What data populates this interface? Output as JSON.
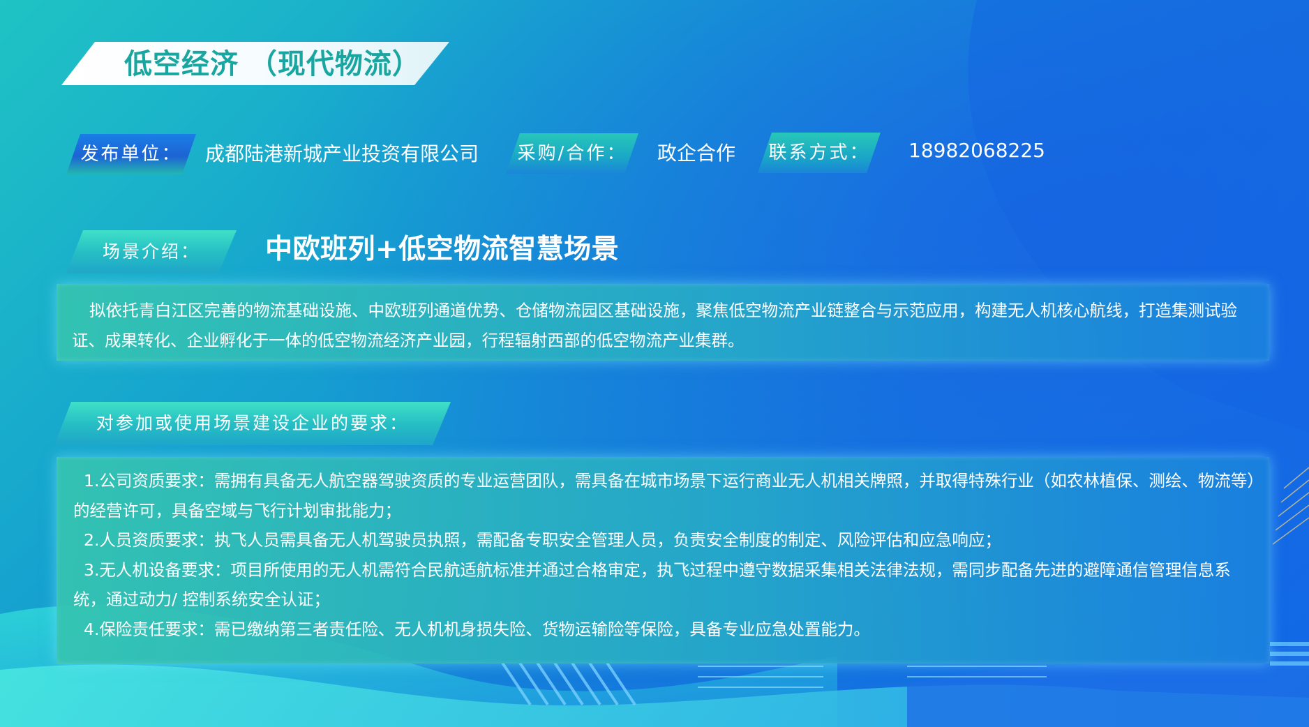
{
  "title": "低空经济 （现代物流）",
  "info": {
    "publisher_label": "发布单位：",
    "publisher_value": "成都陆港新城产业投资有限公司",
    "cooperation_label": "采购/合作：",
    "cooperation_value": "政企合作",
    "contact_label": "联系方式：",
    "contact_value": "18982068225"
  },
  "scene": {
    "label": "场景介绍：",
    "heading": "中欧班列+低空物流智慧场景",
    "description": "拟依托青白江区完善的物流基础设施、中欧班列通道优势、仓储物流园区基础设施，聚焦低空物流产业链整合与示范应用，构建无人机核心航线，打造集测试验证、成果转化、企业孵化于一体的低空物流经济产业园，行程辐射西部的低空物流产业集群。"
  },
  "requirements": {
    "label": "对参加或使用场景建设企业的要求：",
    "items": [
      "1.公司资质要求：需拥有具备无人航空器驾驶资质的专业运营团队，需具备在城市场景下运行商业无人机相关牌照，并取得特殊行业（如农林植保、测绘、物流等）的经营许可，具备空域与飞行计划审批能力；",
      "2.人员资质要求：执飞人员需具备无人机驾驶员执照，需配备专职安全管理人员，负责安全制度的制定、风险评估和应急响应；",
      "3.无人机设备要求：项目所使用的无人机需符合民航适航标准并通过合格审定，执飞过程中遵守数据采集相关法律法规，需同步配备先进的避障通信管理信息系统，通过动力/ 控制系统安全认证；",
      "4.保险责任要求：需已缴纳第三者责任险、无人机机身损失险、货物运输险等保险，具备专业应急处置能力。"
    ]
  },
  "colors": {
    "title_text": "#1aa6a0",
    "panel_start": "#35c4b0",
    "panel_end": "#1a82de",
    "background_deep": "#1266e8"
  }
}
